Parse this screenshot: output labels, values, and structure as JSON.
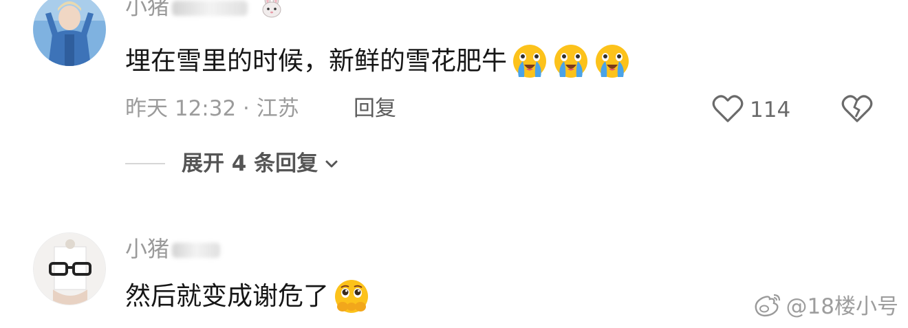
{
  "comments": [
    {
      "username": "小猪",
      "username_emoji": "rabbit-face",
      "text": "埋在雪里的时候，新鲜的雪花肥牛",
      "emojis": [
        "loudly-crying-face",
        "loudly-crying-face",
        "loudly-crying-face"
      ],
      "time_location": "昨天 12:32 · 江苏",
      "reply_label": "回复",
      "like_count": "114",
      "expand_label": "展开 4 条回复"
    },
    {
      "username": "小猪",
      "text": "然后就变成谢危了",
      "emojis": [
        "face-holding-back-tears"
      ]
    }
  ],
  "watermark": {
    "text": "@18楼小号",
    "icon": "weibo-logo"
  }
}
